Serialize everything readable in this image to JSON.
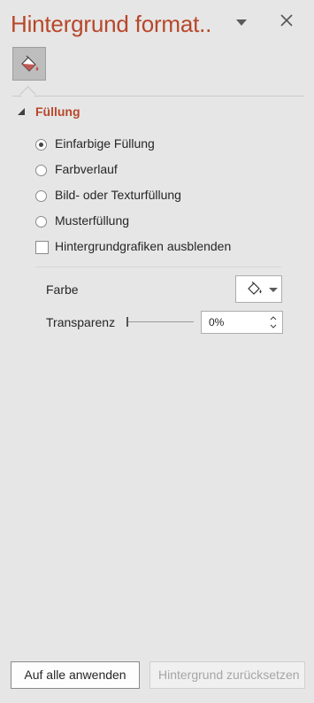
{
  "pane": {
    "title": "Hintergrund formatieren",
    "title_display": "Hintergrund format..",
    "menu_icon": "chevron-down-icon",
    "close_icon": "close-icon",
    "accent_color": "#b7472a"
  },
  "tabs": [
    {
      "name": "fill-bucket-icon",
      "active": true
    }
  ],
  "section": {
    "label": "Füllung",
    "expanded": true
  },
  "fill_options": [
    {
      "label": "Einfarbige Füllung",
      "type": "radio",
      "checked": true
    },
    {
      "label": "Farbverlauf",
      "type": "radio",
      "checked": false
    },
    {
      "label": "Bild- oder Texturfüllung",
      "type": "radio",
      "checked": false
    },
    {
      "label": "Musterfüllung",
      "type": "radio",
      "checked": false
    },
    {
      "label": "Hintergrundgrafiken ausblenden",
      "type": "checkbox",
      "checked": false
    }
  ],
  "properties": {
    "color_label": "Farbe",
    "transparency_label": "Transparenz",
    "transparency_value": "0%",
    "transparency_slider_fraction": 0
  },
  "footer": {
    "apply_all_label": "Auf alle anwenden",
    "reset_label": "Hintergrund zurücksetzen"
  }
}
